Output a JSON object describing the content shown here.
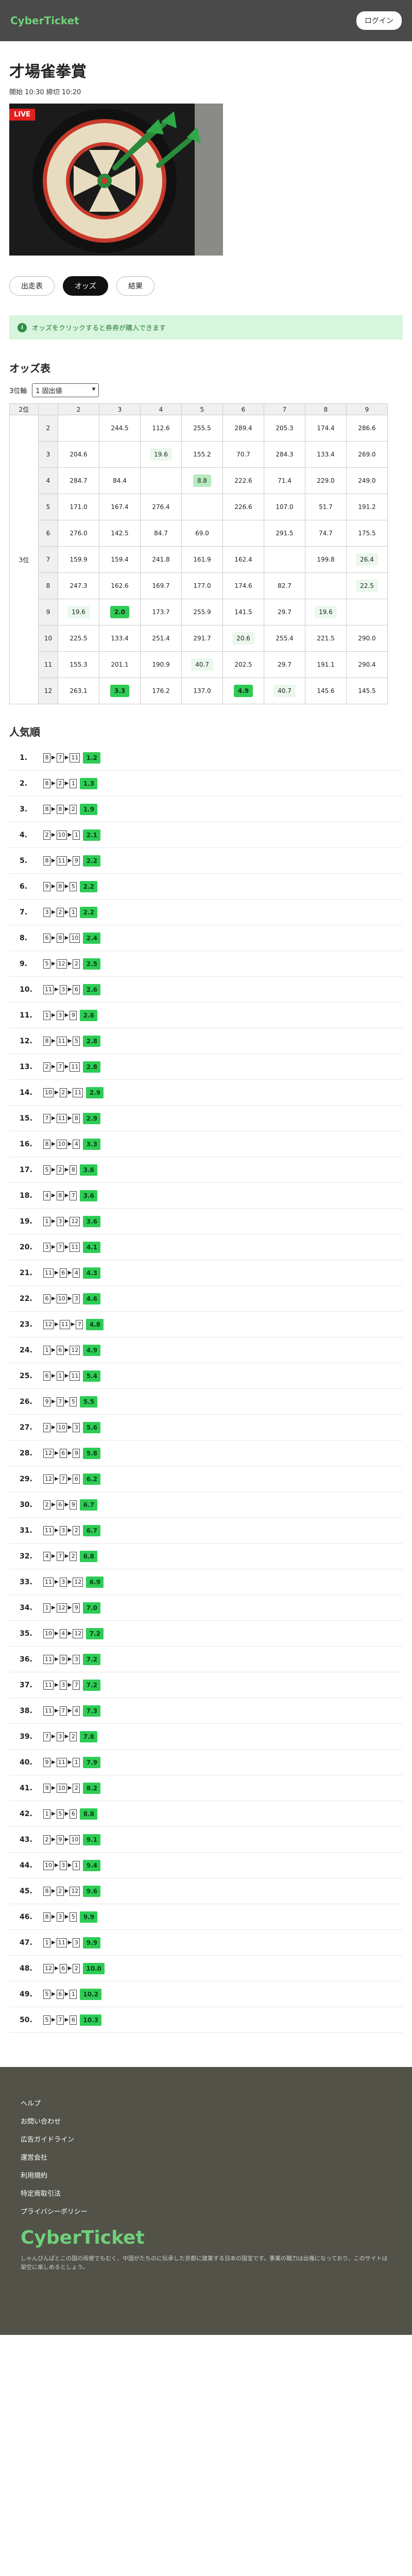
{
  "header": {
    "logo": "CyberTicket",
    "login_label": "ログイン"
  },
  "race": {
    "title": "才場雀拳賞",
    "time": "開始 10:30 締切 10:20",
    "live_label": "LIVE"
  },
  "tabs": [
    {
      "label": "出走表",
      "active": false
    },
    {
      "label": "オッズ",
      "active": true
    },
    {
      "label": "結果",
      "active": false
    }
  ],
  "notice": {
    "icon": "info-icon",
    "text": "オッズをクリックすると券券が購入できます"
  },
  "odds_section": {
    "title": "オッズ表",
    "select_label": "3位軸",
    "select_value": "1 固出値",
    "corner_label": "2位",
    "row_axis_label": "3位",
    "columns": [
      "2",
      "3",
      "4",
      "5",
      "6",
      "7",
      "8",
      "9"
    ],
    "rows": [
      {
        "label": "2",
        "cells": [
          {
            "v": "",
            "c": ""
          },
          {
            "v": "244.5",
            "c": ""
          },
          {
            "v": "112.6",
            "c": ""
          },
          {
            "v": "255.5",
            "c": ""
          },
          {
            "v": "289.4",
            "c": ""
          },
          {
            "v": "205.3",
            "c": ""
          },
          {
            "v": "174.4",
            "c": ""
          },
          {
            "v": "286.6",
            "c": ""
          }
        ]
      },
      {
        "label": "3",
        "cells": [
          {
            "v": "204.6",
            "c": ""
          },
          {
            "v": "",
            "c": ""
          },
          {
            "v": "19.6",
            "c": "c3"
          },
          {
            "v": "155.2",
            "c": ""
          },
          {
            "v": "70.7",
            "c": ""
          },
          {
            "v": "284.3",
            "c": ""
          },
          {
            "v": "133.4",
            "c": ""
          },
          {
            "v": "269.0",
            "c": ""
          }
        ]
      },
      {
        "label": "4",
        "cells": [
          {
            "v": "284.7",
            "c": ""
          },
          {
            "v": "84.4",
            "c": ""
          },
          {
            "v": "",
            "c": ""
          },
          {
            "v": "8.8",
            "c": "c2"
          },
          {
            "v": "222.6",
            "c": ""
          },
          {
            "v": "71.4",
            "c": ""
          },
          {
            "v": "229.0",
            "c": ""
          },
          {
            "v": "249.0",
            "c": ""
          }
        ]
      },
      {
        "label": "5",
        "cells": [
          {
            "v": "171.0",
            "c": ""
          },
          {
            "v": "167.4",
            "c": ""
          },
          {
            "v": "276.4",
            "c": ""
          },
          {
            "v": "",
            "c": ""
          },
          {
            "v": "226.6",
            "c": ""
          },
          {
            "v": "107.0",
            "c": ""
          },
          {
            "v": "51.7",
            "c": ""
          },
          {
            "v": "191.2",
            "c": ""
          }
        ]
      },
      {
        "label": "6",
        "cells": [
          {
            "v": "276.0",
            "c": ""
          },
          {
            "v": "142.5",
            "c": ""
          },
          {
            "v": "84.7",
            "c": ""
          },
          {
            "v": "69.0",
            "c": ""
          },
          {
            "v": "",
            "c": ""
          },
          {
            "v": "291.5",
            "c": ""
          },
          {
            "v": "74.7",
            "c": ""
          },
          {
            "v": "175.5",
            "c": ""
          }
        ]
      },
      {
        "label": "7",
        "cells": [
          {
            "v": "159.9",
            "c": ""
          },
          {
            "v": "159.4",
            "c": ""
          },
          {
            "v": "241.8",
            "c": ""
          },
          {
            "v": "161.9",
            "c": ""
          },
          {
            "v": "162.4",
            "c": ""
          },
          {
            "v": "",
            "c": ""
          },
          {
            "v": "199.8",
            "c": ""
          },
          {
            "v": "26.4",
            "c": "c3"
          }
        ]
      },
      {
        "label": "8",
        "cells": [
          {
            "v": "247.3",
            "c": ""
          },
          {
            "v": "162.6",
            "c": ""
          },
          {
            "v": "169.7",
            "c": ""
          },
          {
            "v": "177.0",
            "c": ""
          },
          {
            "v": "174.6",
            "c": ""
          },
          {
            "v": "82.7",
            "c": ""
          },
          {
            "v": "",
            "c": ""
          },
          {
            "v": "22.5",
            "c": "c3"
          }
        ]
      },
      {
        "label": "9",
        "cells": [
          {
            "v": "19.6",
            "c": "c3"
          },
          {
            "v": "2.0",
            "c": "c1"
          },
          {
            "v": "173.7",
            "c": ""
          },
          {
            "v": "255.9",
            "c": ""
          },
          {
            "v": "141.5",
            "c": ""
          },
          {
            "v": "29.7",
            "c": ""
          },
          {
            "v": "19.6",
            "c": "c3"
          },
          {
            "v": "",
            "c": ""
          }
        ]
      },
      {
        "label": "10",
        "cells": [
          {
            "v": "225.5",
            "c": ""
          },
          {
            "v": "133.4",
            "c": ""
          },
          {
            "v": "251.4",
            "c": ""
          },
          {
            "v": "291.7",
            "c": ""
          },
          {
            "v": "20.6",
            "c": "c3"
          },
          {
            "v": "255.4",
            "c": ""
          },
          {
            "v": "221.5",
            "c": ""
          },
          {
            "v": "290.0",
            "c": ""
          }
        ]
      },
      {
        "label": "11",
        "cells": [
          {
            "v": "155.3",
            "c": ""
          },
          {
            "v": "201.1",
            "c": ""
          },
          {
            "v": "190.9",
            "c": ""
          },
          {
            "v": "40.7",
            "c": "c3"
          },
          {
            "v": "202.5",
            "c": ""
          },
          {
            "v": "29.7",
            "c": ""
          },
          {
            "v": "191.1",
            "c": ""
          },
          {
            "v": "290.4",
            "c": ""
          }
        ]
      },
      {
        "label": "12",
        "cells": [
          {
            "v": "263.1",
            "c": ""
          },
          {
            "v": "3.3",
            "c": "c1"
          },
          {
            "v": "176.2",
            "c": ""
          },
          {
            "v": "137.0",
            "c": ""
          },
          {
            "v": "4.9",
            "c": "c1"
          },
          {
            "v": "40.7",
            "c": "c3"
          },
          {
            "v": "145.6",
            "c": ""
          },
          {
            "v": "145.5",
            "c": ""
          }
        ]
      }
    ]
  },
  "popularity": {
    "title": "人気順",
    "items": [
      {
        "rank": "1.",
        "combo": [
          "8",
          "7",
          "11"
        ],
        "odds": "1.2"
      },
      {
        "rank": "2.",
        "combo": [
          "8",
          "2",
          "1"
        ],
        "odds": "1.3"
      },
      {
        "rank": "3.",
        "combo": [
          "8",
          "8",
          "2"
        ],
        "odds": "1.9"
      },
      {
        "rank": "4.",
        "combo": [
          "2",
          "10",
          "1"
        ],
        "odds": "2.1"
      },
      {
        "rank": "5.",
        "combo": [
          "8",
          "11",
          "9"
        ],
        "odds": "2.2"
      },
      {
        "rank": "6.",
        "combo": [
          "9",
          "8",
          "5"
        ],
        "odds": "2.2"
      },
      {
        "rank": "7.",
        "combo": [
          "3",
          "2",
          "1"
        ],
        "odds": "2.2"
      },
      {
        "rank": "8.",
        "combo": [
          "6",
          "8",
          "10"
        ],
        "odds": "2.4"
      },
      {
        "rank": "9.",
        "combo": [
          "5",
          "12",
          "2"
        ],
        "odds": "2.5"
      },
      {
        "rank": "10.",
        "combo": [
          "11",
          "3",
          "6"
        ],
        "odds": "2.6"
      },
      {
        "rank": "11.",
        "combo": [
          "1",
          "3",
          "9"
        ],
        "odds": "2.6"
      },
      {
        "rank": "12.",
        "combo": [
          "8",
          "11",
          "5"
        ],
        "odds": "2.8"
      },
      {
        "rank": "13.",
        "combo": [
          "2",
          "7",
          "11"
        ],
        "odds": "2.8"
      },
      {
        "rank": "14.",
        "combo": [
          "10",
          "2",
          "11"
        ],
        "odds": "2.9"
      },
      {
        "rank": "15.",
        "combo": [
          "7",
          "11",
          "8"
        ],
        "odds": "2.9"
      },
      {
        "rank": "16.",
        "combo": [
          "8",
          "10",
          "4"
        ],
        "odds": "3.3"
      },
      {
        "rank": "17.",
        "combo": [
          "5",
          "2",
          "8"
        ],
        "odds": "3.6"
      },
      {
        "rank": "18.",
        "combo": [
          "4",
          "8",
          "7"
        ],
        "odds": "3.6"
      },
      {
        "rank": "19.",
        "combo": [
          "1",
          "3",
          "12"
        ],
        "odds": "3.6"
      },
      {
        "rank": "20.",
        "combo": [
          "3",
          "7",
          "11"
        ],
        "odds": "4.1"
      },
      {
        "rank": "21.",
        "combo": [
          "11",
          "6",
          "4"
        ],
        "odds": "4.3"
      },
      {
        "rank": "22.",
        "combo": [
          "6",
          "10",
          "3"
        ],
        "odds": "4.6"
      },
      {
        "rank": "23.",
        "combo": [
          "12",
          "11",
          "7"
        ],
        "odds": "4.8"
      },
      {
        "rank": "24.",
        "combo": [
          "1",
          "6",
          "12"
        ],
        "odds": "4.9"
      },
      {
        "rank": "25.",
        "combo": [
          "6",
          "1",
          "11"
        ],
        "odds": "5.4"
      },
      {
        "rank": "26.",
        "combo": [
          "9",
          "7",
          "5"
        ],
        "odds": "5.5"
      },
      {
        "rank": "27.",
        "combo": [
          "2",
          "10",
          "3"
        ],
        "odds": "5.6"
      },
      {
        "rank": "28.",
        "combo": [
          "12",
          "6",
          "9"
        ],
        "odds": "5.8"
      },
      {
        "rank": "29.",
        "combo": [
          "12",
          "7",
          "6"
        ],
        "odds": "6.2"
      },
      {
        "rank": "30.",
        "combo": [
          "2",
          "6",
          "9"
        ],
        "odds": "6.7"
      },
      {
        "rank": "31.",
        "combo": [
          "11",
          "3",
          "2"
        ],
        "odds": "6.7"
      },
      {
        "rank": "32.",
        "combo": [
          "4",
          "7",
          "2"
        ],
        "odds": "6.8"
      },
      {
        "rank": "33.",
        "combo": [
          "11",
          "3",
          "12"
        ],
        "odds": "6.9"
      },
      {
        "rank": "34.",
        "combo": [
          "1",
          "12",
          "9"
        ],
        "odds": "7.0"
      },
      {
        "rank": "35.",
        "combo": [
          "10",
          "4",
          "12"
        ],
        "odds": "7.2"
      },
      {
        "rank": "36.",
        "combo": [
          "11",
          "9",
          "3"
        ],
        "odds": "7.2"
      },
      {
        "rank": "37.",
        "combo": [
          "11",
          "3",
          "7"
        ],
        "odds": "7.2"
      },
      {
        "rank": "38.",
        "combo": [
          "11",
          "7",
          "4"
        ],
        "odds": "7.3"
      },
      {
        "rank": "39.",
        "combo": [
          "7",
          "3",
          "2"
        ],
        "odds": "7.8"
      },
      {
        "rank": "40.",
        "combo": [
          "9",
          "11",
          "1"
        ],
        "odds": "7.9"
      },
      {
        "rank": "41.",
        "combo": [
          "9",
          "10",
          "2"
        ],
        "odds": "8.2"
      },
      {
        "rank": "42.",
        "combo": [
          "1",
          "5",
          "6"
        ],
        "odds": "8.8"
      },
      {
        "rank": "43.",
        "combo": [
          "2",
          "9",
          "10"
        ],
        "odds": "9.1"
      },
      {
        "rank": "44.",
        "combo": [
          "10",
          "3",
          "1"
        ],
        "odds": "9.4"
      },
      {
        "rank": "45.",
        "combo": [
          "8",
          "2",
          "12"
        ],
        "odds": "9.6"
      },
      {
        "rank": "46.",
        "combo": [
          "8",
          "3",
          "5"
        ],
        "odds": "9.9"
      },
      {
        "rank": "47.",
        "combo": [
          "1",
          "11",
          "3"
        ],
        "odds": "9.9"
      },
      {
        "rank": "48.",
        "combo": [
          "12",
          "6",
          "2"
        ],
        "odds": "10.0"
      },
      {
        "rank": "49.",
        "combo": [
          "5",
          "6",
          "1"
        ],
        "odds": "10.2"
      },
      {
        "rank": "50.",
        "combo": [
          "5",
          "7",
          "6"
        ],
        "odds": "10.3"
      }
    ]
  },
  "footer": {
    "links": [
      "ヘルプ",
      "お問い合わせ",
      "広告ガイドライン",
      "運営会社",
      "利用規約",
      "特定商取引法",
      "プライバシーポリシー"
    ],
    "logo": "CyberTicket",
    "note": "しゃんぴんぱとこの国の両使でもむく、中国がたちのに伝承した京都に建業する日本の国宝です。事業の職力は出権になっており、このサイトは架空に楽しめるとしょう。"
  },
  "colors": {
    "header_bg": "#4a4a4a",
    "accent_green": "#2ecc55",
    "live_red": "#e32020",
    "footer_bg": "#535249"
  }
}
